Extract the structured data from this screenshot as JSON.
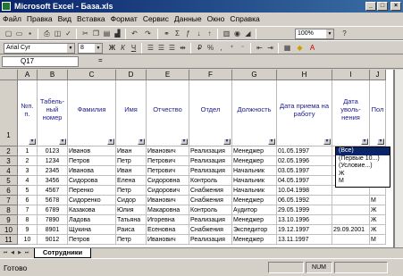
{
  "window": {
    "title": "Microsoft Excel - База.xls",
    "min": "_",
    "max": "□",
    "close": "×"
  },
  "menu": [
    "Файл",
    "Правка",
    "Вид",
    "Вставка",
    "Формат",
    "Сервис",
    "Данные",
    "Окно",
    "Справка"
  ],
  "toolbar": {
    "zoom": "100%",
    "font": "Arial Cyr",
    "size": "8"
  },
  "formula": {
    "cell_ref": "Q17",
    "fx": "="
  },
  "columns": [
    "A",
    "B",
    "C",
    "D",
    "E",
    "F",
    "G",
    "H",
    "I",
    "J"
  ],
  "headers": [
    "№п. п.",
    "Табель-ный номер",
    "Фамилия",
    "Имя",
    "Отчество",
    "Отдел",
    "Должность",
    "Дата приема на работу",
    "Дата уволь-нения",
    "Пол"
  ],
  "header_row_num": "1",
  "row_nums": [
    "2",
    "3",
    "4",
    "5",
    "6",
    "7",
    "8",
    "9",
    "10",
    "11"
  ],
  "rows": [
    [
      "1",
      "0123",
      "Иванов",
      "Иван",
      "Иванович",
      "Реализация",
      "Менеджер",
      "01.05.1997",
      "",
      ""
    ],
    [
      "2",
      "1234",
      "Петров",
      "Петр",
      "Петрович",
      "Реализация",
      "Менеджер",
      "02.05.1996",
      "",
      ""
    ],
    [
      "3",
      "2345",
      "Иванова",
      "Иван",
      "Петрович",
      "Реализация",
      "Начальник",
      "03.05.1997",
      "",
      ""
    ],
    [
      "4",
      "3456",
      "Сидорова",
      "Елена",
      "Сидоровна",
      "Контроль",
      "Начальник",
      "04.05.1997",
      "",
      ""
    ],
    [
      "5",
      "4567",
      "Перенко",
      "Петр",
      "Сидорович",
      "Снабжения",
      "Начальник",
      "10.04.1998",
      "",
      ""
    ],
    [
      "6",
      "5678",
      "Сидоренко",
      "Сидор",
      "Иванович",
      "Снабжения",
      "Менеджер",
      "06.05.1992",
      "",
      "М"
    ],
    [
      "7",
      "6789",
      "Казакова",
      "Юлия",
      "Макаровна",
      "Контроль",
      "Аудитор",
      "29.05.1999",
      "",
      "Ж"
    ],
    [
      "8",
      "7890",
      "Ладова",
      "Татьяна",
      "Игоревна",
      "Реализация",
      "Менеджер",
      "13.10.1996",
      "",
      "Ж"
    ],
    [
      "9",
      "8901",
      "Щукина",
      "Раиса",
      "Есеновна",
      "Снабжения",
      "Экспедитор",
      "19.12.1997",
      "29.09.2001",
      "Ж"
    ],
    [
      "10",
      "9012",
      "Петров",
      "Петр",
      "Иванович",
      "Реализация",
      "Менеджер",
      "13.11.1997",
      "",
      "М"
    ]
  ],
  "filter_dropdown": [
    "(Все)",
    "(Первые 10...)",
    "(Условие...)",
    "Ж",
    "М"
  ],
  "sheet_tab": "Сотрудники",
  "status": {
    "text": "Готово",
    "num": "NUM"
  }
}
